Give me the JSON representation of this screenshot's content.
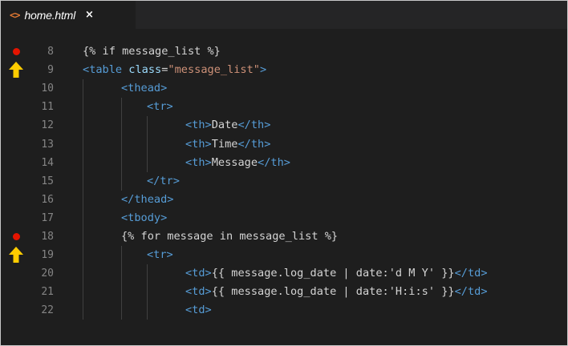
{
  "tab": {
    "icon": "<>",
    "label": "home.html",
    "close": "×"
  },
  "lines": [
    {
      "n": "8",
      "marker": "breakpoint",
      "parts": [
        {
          "t": "{% if message_list %}",
          "c": "txt"
        }
      ]
    },
    {
      "n": "9",
      "marker": "current",
      "parts": [
        {
          "t": "<",
          "c": "tag"
        },
        {
          "t": "table",
          "c": "tag"
        },
        {
          "t": " ",
          "c": "txt"
        },
        {
          "t": "class",
          "c": "attr"
        },
        {
          "t": "=",
          "c": "txt"
        },
        {
          "t": "\"message_list\"",
          "c": "str"
        },
        {
          "t": ">",
          "c": "tag"
        }
      ]
    },
    {
      "n": "10",
      "marker": "",
      "parts": [
        {
          "t": "<thead>",
          "c": "tag"
        }
      ]
    },
    {
      "n": "11",
      "marker": "",
      "parts": [
        {
          "t": "<tr>",
          "c": "tag"
        }
      ]
    },
    {
      "n": "12",
      "marker": "",
      "parts": [
        {
          "t": "<th>",
          "c": "tag"
        },
        {
          "t": "Date",
          "c": "txt"
        },
        {
          "t": "</th>",
          "c": "tag"
        }
      ]
    },
    {
      "n": "13",
      "marker": "",
      "parts": [
        {
          "t": "<th>",
          "c": "tag"
        },
        {
          "t": "Time",
          "c": "txt"
        },
        {
          "t": "</th>",
          "c": "tag"
        }
      ]
    },
    {
      "n": "14",
      "marker": "",
      "parts": [
        {
          "t": "<th>",
          "c": "tag"
        },
        {
          "t": "Message",
          "c": "txt"
        },
        {
          "t": "</th>",
          "c": "tag"
        }
      ]
    },
    {
      "n": "15",
      "marker": "",
      "parts": [
        {
          "t": "</tr>",
          "c": "tag"
        }
      ]
    },
    {
      "n": "16",
      "marker": "",
      "parts": [
        {
          "t": "</thead>",
          "c": "tag"
        }
      ]
    },
    {
      "n": "17",
      "marker": "",
      "parts": [
        {
          "t": "<tbody>",
          "c": "tag"
        }
      ]
    },
    {
      "n": "18",
      "marker": "breakpoint",
      "parts": [
        {
          "t": "{% for message in message_list %}",
          "c": "txt"
        }
      ]
    },
    {
      "n": "19",
      "marker": "current",
      "parts": [
        {
          "t": "<tr>",
          "c": "tag"
        }
      ]
    },
    {
      "n": "20",
      "marker": "",
      "parts": [
        {
          "t": "<td>",
          "c": "tag"
        },
        {
          "t": "{{ message.log_date | date:'d M Y' }}",
          "c": "txt"
        },
        {
          "t": "</td>",
          "c": "tag"
        }
      ]
    },
    {
      "n": "21",
      "marker": "",
      "parts": [
        {
          "t": "<td>",
          "c": "tag"
        },
        {
          "t": "{{ message.log_date | date:'H:i:s' }}",
          "c": "txt"
        },
        {
          "t": "</td>",
          "c": "tag"
        }
      ]
    },
    {
      "n": "22",
      "marker": "",
      "parts": [
        {
          "t": "<td>",
          "c": "tag"
        }
      ]
    }
  ],
  "colors": {
    "breakpoint": "#e51400",
    "current_arrow": "#ffcc00",
    "tag": "#569cd6",
    "attribute": "#9cdcfe",
    "string": "#ce9178",
    "text": "#d4d4d4",
    "line_number": "#858585"
  }
}
